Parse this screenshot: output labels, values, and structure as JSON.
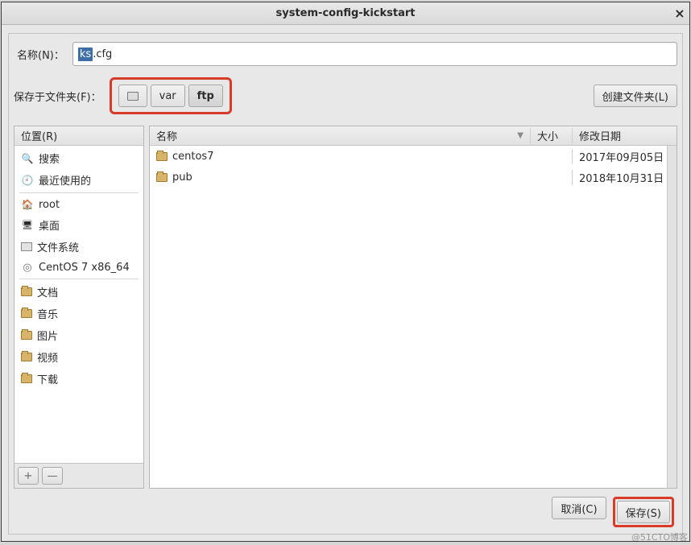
{
  "window": {
    "title": "system-config-kickstart"
  },
  "form": {
    "name_label": "名称(N)：",
    "filename_selected": "ks",
    "filename_rest": ".cfg",
    "folder_label": "保存于文件夹(F)：",
    "create_folder_btn": "创建文件夹(L)"
  },
  "breadcrumb": {
    "seg0": "",
    "seg1": "var",
    "seg2": "ftp"
  },
  "sidebar": {
    "header": "位置(R)",
    "items": [
      {
        "label": "搜索",
        "icon": "search"
      },
      {
        "label": "最近使用的",
        "icon": "recent"
      },
      {
        "label": "root",
        "icon": "home",
        "sep_before": true
      },
      {
        "label": "桌面",
        "icon": "desktop"
      },
      {
        "label": "文件系统",
        "icon": "fs"
      },
      {
        "label": "CentOS 7 x86_64",
        "icon": "disc"
      },
      {
        "label": "文档",
        "icon": "folder",
        "sep_before": true
      },
      {
        "label": "音乐",
        "icon": "folder"
      },
      {
        "label": "图片",
        "icon": "folder"
      },
      {
        "label": "视频",
        "icon": "folder"
      },
      {
        "label": "下载",
        "icon": "folder"
      }
    ],
    "add_btn": "+",
    "remove_btn": "—"
  },
  "filelist": {
    "columns": {
      "name": "名称",
      "size": "大小",
      "date": "修改日期"
    },
    "rows": [
      {
        "name": "centos7",
        "size": "",
        "date": "2017年09月05日"
      },
      {
        "name": "pub",
        "size": "",
        "date": "2018年10月31日"
      }
    ]
  },
  "actions": {
    "cancel": "取消(C)",
    "save": "保存(S)"
  },
  "watermark": "@51CTO博客"
}
